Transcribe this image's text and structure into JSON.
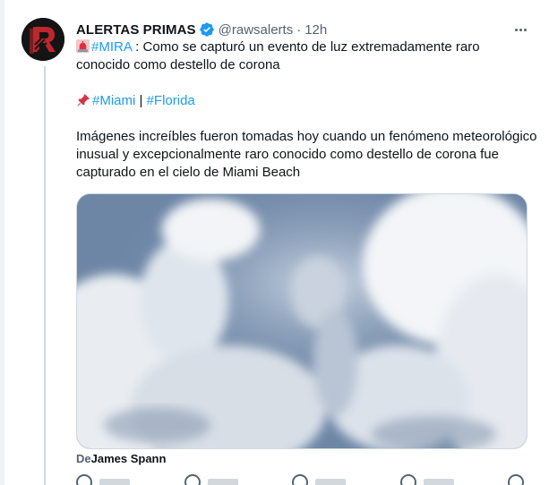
{
  "tweet": {
    "display_name": "ALERTAS PRIMAS",
    "handle": "@rawsalerts",
    "separator": "·",
    "time": "12h",
    "line1": {
      "hashtag": "#MIRA",
      "text": " : Como se capturó un evento de luz extremadamente raro conocido como destello de corona"
    },
    "line2": {
      "hashtag1": "#Miami",
      "sep": " | ",
      "hashtag2": "#Florida"
    },
    "body": "Imágenes increíbles fueron tomadas hoy cuando un fenómeno meteorológico inusual y excepcionalmente raro conocido como destello de corona fue capturado en el cielo de Miami Beach",
    "credit_prefix": "De",
    "credit_name": "James Spann"
  },
  "icons": {
    "avatar": "raw-logo",
    "verified": "verified-badge-icon",
    "more": "more-options-icon",
    "siren": "rotating-light-emoji",
    "pin": "pushpin-emoji"
  },
  "colors": {
    "accent": "#1d9bf0",
    "text": "#0f1419",
    "secondary": "#536471",
    "avatar_red": "#c0262d"
  }
}
